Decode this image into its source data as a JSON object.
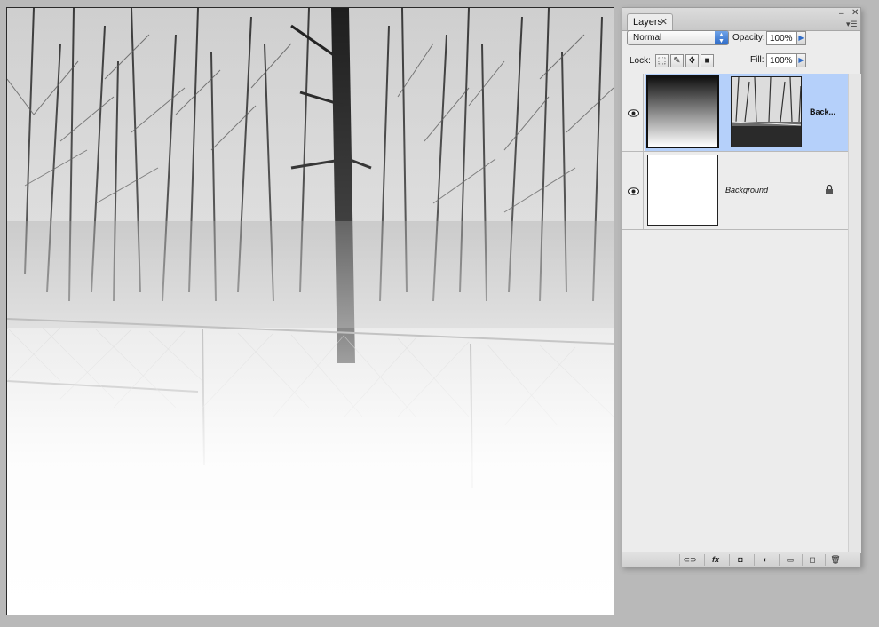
{
  "panel": {
    "tab_label": "Layers",
    "tab_close": "✕",
    "minimize_glyph": "‒",
    "close_glyph": "✕",
    "menu_glyph": "▾☰",
    "blend_mode": "Normal",
    "opacity_label": "Opacity:",
    "opacity_value": "100%",
    "lock_label": "Lock:",
    "fill_label": "Fill:",
    "fill_value": "100%",
    "flyout_glyph": "▶",
    "lock_icons": [
      "lock-transparent-icon",
      "lock-image-icon",
      "lock-position-icon",
      "lock-all-icon"
    ],
    "layers": [
      {
        "name": "Back...",
        "selected": true,
        "visible": true,
        "has_mask": true
      },
      {
        "name": "Background",
        "selected": false,
        "visible": true,
        "locked": true
      }
    ],
    "bottom_icons": [
      "link-layers-icon",
      "fx-icon",
      "add-mask-icon",
      "adjustment-layer-icon",
      "new-group-icon",
      "new-layer-icon",
      "trash-icon"
    ],
    "fx_text": "fx"
  },
  "colors": {
    "selection": "#b5d0fa",
    "accent": "#2f6cc8",
    "background": "#b9b9b9"
  }
}
